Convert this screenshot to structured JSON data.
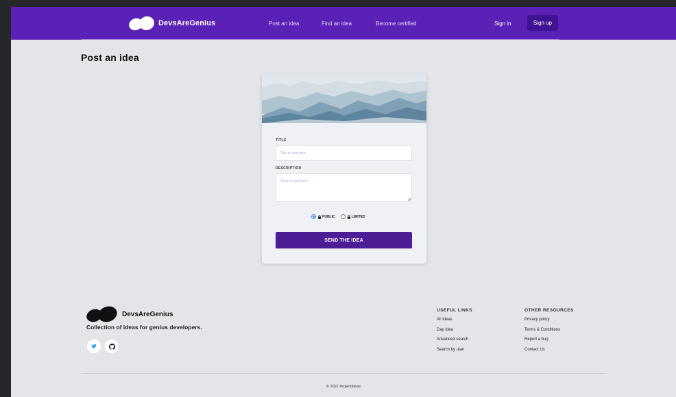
{
  "nav": {
    "brand": "DevsAreGenius",
    "links": [
      "Post an idea",
      "Find an idea",
      "Become certified"
    ],
    "signin": "Sign in",
    "signup": "Sign up",
    "bg_color": "#5b21b6"
  },
  "page": {
    "title": "Post an idea"
  },
  "form": {
    "title_label": "TITLE",
    "title_placeholder": "Title of your idea",
    "title_value": "",
    "description_label": "DESCRIPTION",
    "description_placeholder": "What is your idea?",
    "description_value": "",
    "visibility_options": [
      {
        "label": "PUBLIC",
        "selected": true,
        "icon": "lock-icon"
      },
      {
        "label": "LIMITED",
        "selected": false,
        "icon": "lock-icon"
      }
    ],
    "submit_label": "SEND THE IDEA",
    "submit_color": "#4c1d95"
  },
  "footer": {
    "brand": "DevsAreGenius",
    "tagline": "Collection of ideas for genius developers.",
    "social": [
      "twitter-icon",
      "github-icon"
    ],
    "useful_links": {
      "heading": "USEFUL LINKS",
      "items": [
        "All ideas",
        "Day idea",
        "Advanced search",
        "Search by user"
      ]
    },
    "other_resources": {
      "heading": "OTHER RESOURCES",
      "items": [
        "Privacy policy",
        "Terms & Conditions",
        "Report a bug",
        "Contact Us"
      ]
    },
    "copyright": "© 2021 ProjectIdeas"
  }
}
